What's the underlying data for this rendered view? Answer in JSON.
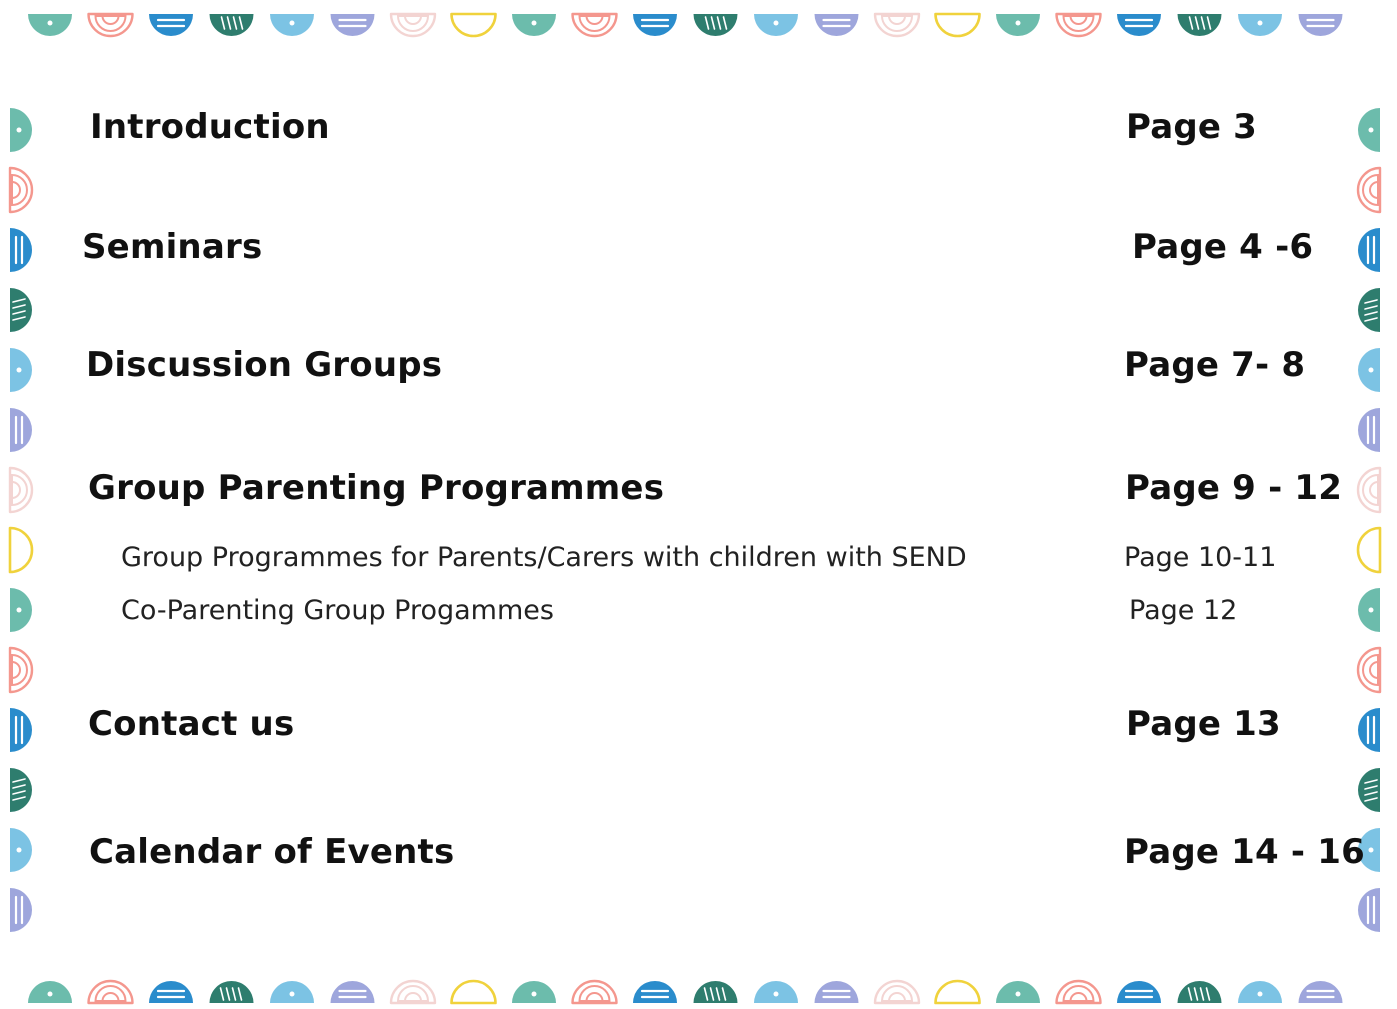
{
  "toc": {
    "entries": [
      {
        "title": "Introduction",
        "page": "Page 3",
        "level": "main"
      },
      {
        "title": "Seminars",
        "page": "Page 4 -6",
        "level": "main"
      },
      {
        "title": "Discussion Groups",
        "page": "Page 7- 8",
        "level": "main"
      },
      {
        "title": "Group Parenting Programmes",
        "page": "Page 9 - 12",
        "level": "main"
      },
      {
        "title": "Group Programmes for Parents/Carers with children with SEND",
        "page": "Page 10-11",
        "level": "sub"
      },
      {
        "title": "Co-Parenting Group Progammes",
        "page": "Page 12",
        "level": "sub"
      },
      {
        "title": "Contact us",
        "page": "Page 13",
        "level": "main"
      },
      {
        "title": "Calendar of Events",
        "page": "Page 14 - 16",
        "level": "main"
      }
    ]
  },
  "border": {
    "colors": {
      "sage": "#6cbcac",
      "coral": "#f4978e",
      "blue": "#2a8ccc",
      "teal": "#2e7d6e",
      "sky": "#7cc3e4",
      "lavender": "#9ea6dc",
      "blush": "#f3d4d2",
      "yellow": "#f0d23c"
    },
    "motif_sequence": [
      {
        "icon": "dot-dome-icon",
        "color": "sage"
      },
      {
        "icon": "rings-dome-icon",
        "color": "coral"
      },
      {
        "icon": "striped-dome-icon",
        "color": "blue"
      },
      {
        "icon": "hatched-dome-icon",
        "color": "teal"
      },
      {
        "icon": "dot-dome-icon",
        "color": "sky"
      },
      {
        "icon": "striped-dome-icon",
        "color": "lavender"
      },
      {
        "icon": "rings-dome-icon",
        "color": "blush"
      },
      {
        "icon": "outline-dome-icon",
        "color": "yellow"
      }
    ]
  }
}
